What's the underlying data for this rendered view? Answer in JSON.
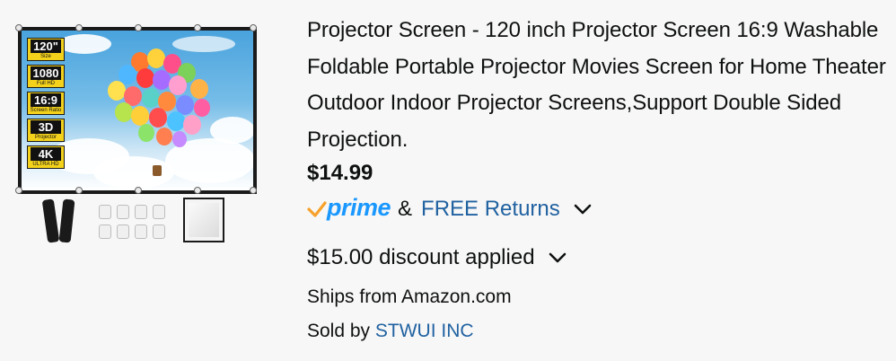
{
  "product": {
    "title": "Projector Screen - 120 inch Projector Screen 16:9 Washable Foldable Portable Projector Movies Screen for Home Theater Outdoor Indoor Projector Screens,Support Double Sided Projection.",
    "price": "$14.99",
    "image_badges": [
      {
        "main": "120\"",
        "sub": "Size"
      },
      {
        "main": "1080",
        "sub": "Full HD"
      },
      {
        "main": "16:9",
        "sub": "Screen Ratio"
      },
      {
        "main": "3D",
        "sub": "Projector"
      },
      {
        "main": "4K",
        "sub": "ULTRA HD"
      }
    ]
  },
  "delivery": {
    "prime_label": "prime",
    "ampersand": "&",
    "returns_link": "FREE Returns"
  },
  "discount": {
    "text": "$15.00 discount applied"
  },
  "fulfillment": {
    "ships_from": "Ships from Amazon.com",
    "sold_by_label": "Sold by",
    "seller_name": "STWUI INC"
  },
  "colors": {
    "prime_blue": "#1a98ff",
    "check_orange": "#f7a12b",
    "link_blue": "#2162a1",
    "badge_yellow": "#f4d21c"
  },
  "icons": [
    "prime-check-icon",
    "chevron-down-icon"
  ]
}
